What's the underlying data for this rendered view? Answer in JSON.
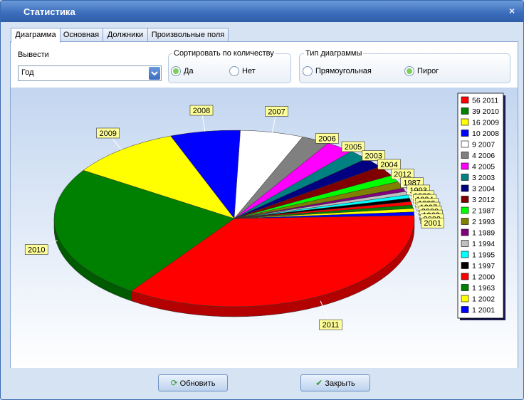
{
  "window": {
    "title": "Статистика",
    "close": "×"
  },
  "tabs": [
    {
      "label": "Диаграмма",
      "active": true
    },
    {
      "label": "Основная",
      "active": false
    },
    {
      "label": "Должники",
      "active": false
    },
    {
      "label": "Произвольные поля",
      "active": false
    }
  ],
  "options": {
    "output_label": "Вывести",
    "output_value": "Год",
    "sort_label": "Сортировать по количеству",
    "sort_yes": "Да",
    "sort_no": "Нет",
    "sort_selected": "yes",
    "type_label": "Тип диаграммы",
    "type_rect": "Прямоугольная",
    "type_pie": "Пирог",
    "type_selected": "pie"
  },
  "chart_data": {
    "type": "pie",
    "legend_placement": "right",
    "slices": [
      {
        "label": "2011",
        "value": 56,
        "legend": "56 2011",
        "color": "#ff0000"
      },
      {
        "label": "2010",
        "value": 39,
        "legend": "39 2010",
        "color": "#008000"
      },
      {
        "label": "2009",
        "value": 16,
        "legend": "16 2009",
        "color": "#ffff00"
      },
      {
        "label": "2008",
        "value": 10,
        "legend": "10 2008",
        "color": "#0000ff"
      },
      {
        "label": "2007",
        "value": 9,
        "legend": "9 2007",
        "color": "#ffffff"
      },
      {
        "label": "2006",
        "value": 4,
        "legend": "4 2006",
        "color": "#808080"
      },
      {
        "label": "2005",
        "value": 4,
        "legend": "4 2005",
        "color": "#ff00ff"
      },
      {
        "label": "2003",
        "value": 3,
        "legend": "3 2003",
        "color": "#008080"
      },
      {
        "label": "2004",
        "value": 3,
        "legend": "3 2004",
        "color": "#000080"
      },
      {
        "label": "2012",
        "value": 3,
        "legend": "3 2012",
        "color": "#800000"
      },
      {
        "label": "1987",
        "value": 2,
        "legend": "2 1987",
        "color": "#00ff00"
      },
      {
        "label": "1993",
        "value": 2,
        "legend": "2 1993",
        "color": "#808000"
      },
      {
        "label": "1989",
        "value": 1,
        "legend": "1 1989",
        "color": "#800080"
      },
      {
        "label": "1994",
        "value": 1,
        "legend": "1 1994",
        "color": "#c0c0c0"
      },
      {
        "label": "1995",
        "value": 1,
        "legend": "1 1995",
        "color": "#00ffff"
      },
      {
        "label": "1997",
        "value": 1,
        "legend": "1 1997",
        "color": "#000000"
      },
      {
        "label": "2000",
        "value": 1,
        "legend": "1 2000",
        "color": "#ff0000"
      },
      {
        "label": "1963",
        "value": 1,
        "legend": "1 1963",
        "color": "#008000"
      },
      {
        "label": "2002",
        "value": 1,
        "legend": "1 2002",
        "color": "#ffff00"
      },
      {
        "label": "2001",
        "value": 1,
        "legend": "1 2001",
        "color": "#0000ff"
      }
    ]
  },
  "footer": {
    "refresh": "Обновить",
    "close": "Закрыть"
  },
  "colors": {
    "label_bg": "#ffff99",
    "accent": "#3d6fbe"
  }
}
